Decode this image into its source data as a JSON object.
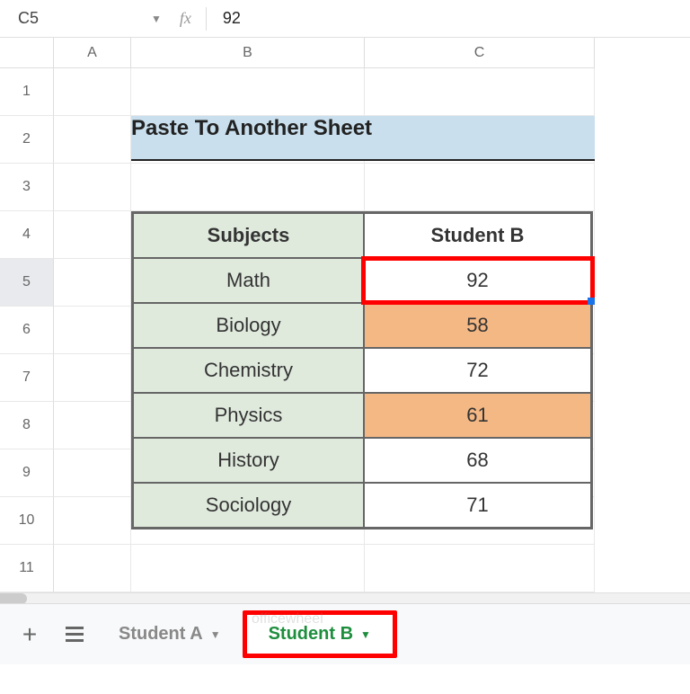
{
  "nameBox": {
    "cellRef": "C5",
    "formulaValue": "92"
  },
  "columns": [
    "A",
    "B",
    "C"
  ],
  "rows": [
    "1",
    "2",
    "3",
    "4",
    "5",
    "6",
    "7",
    "8",
    "9",
    "10",
    "11"
  ],
  "selectedRow": "5",
  "title": "Paste To Another Sheet",
  "table": {
    "headers": [
      "Subjects",
      "Student B"
    ],
    "rows": [
      {
        "subject": "Math",
        "score": "92",
        "highlight": false,
        "selected": true
      },
      {
        "subject": "Biology",
        "score": "58",
        "highlight": true,
        "selected": false
      },
      {
        "subject": "Chemistry",
        "score": "72",
        "highlight": false,
        "selected": false
      },
      {
        "subject": "Physics",
        "score": "61",
        "highlight": true,
        "selected": false
      },
      {
        "subject": "History",
        "score": "68",
        "highlight": false,
        "selected": false
      },
      {
        "subject": "Sociology",
        "score": "71",
        "highlight": false,
        "selected": false
      }
    ]
  },
  "sheetTabs": {
    "inactive": "Student A",
    "active": "Student B"
  },
  "watermark": "officewheel"
}
